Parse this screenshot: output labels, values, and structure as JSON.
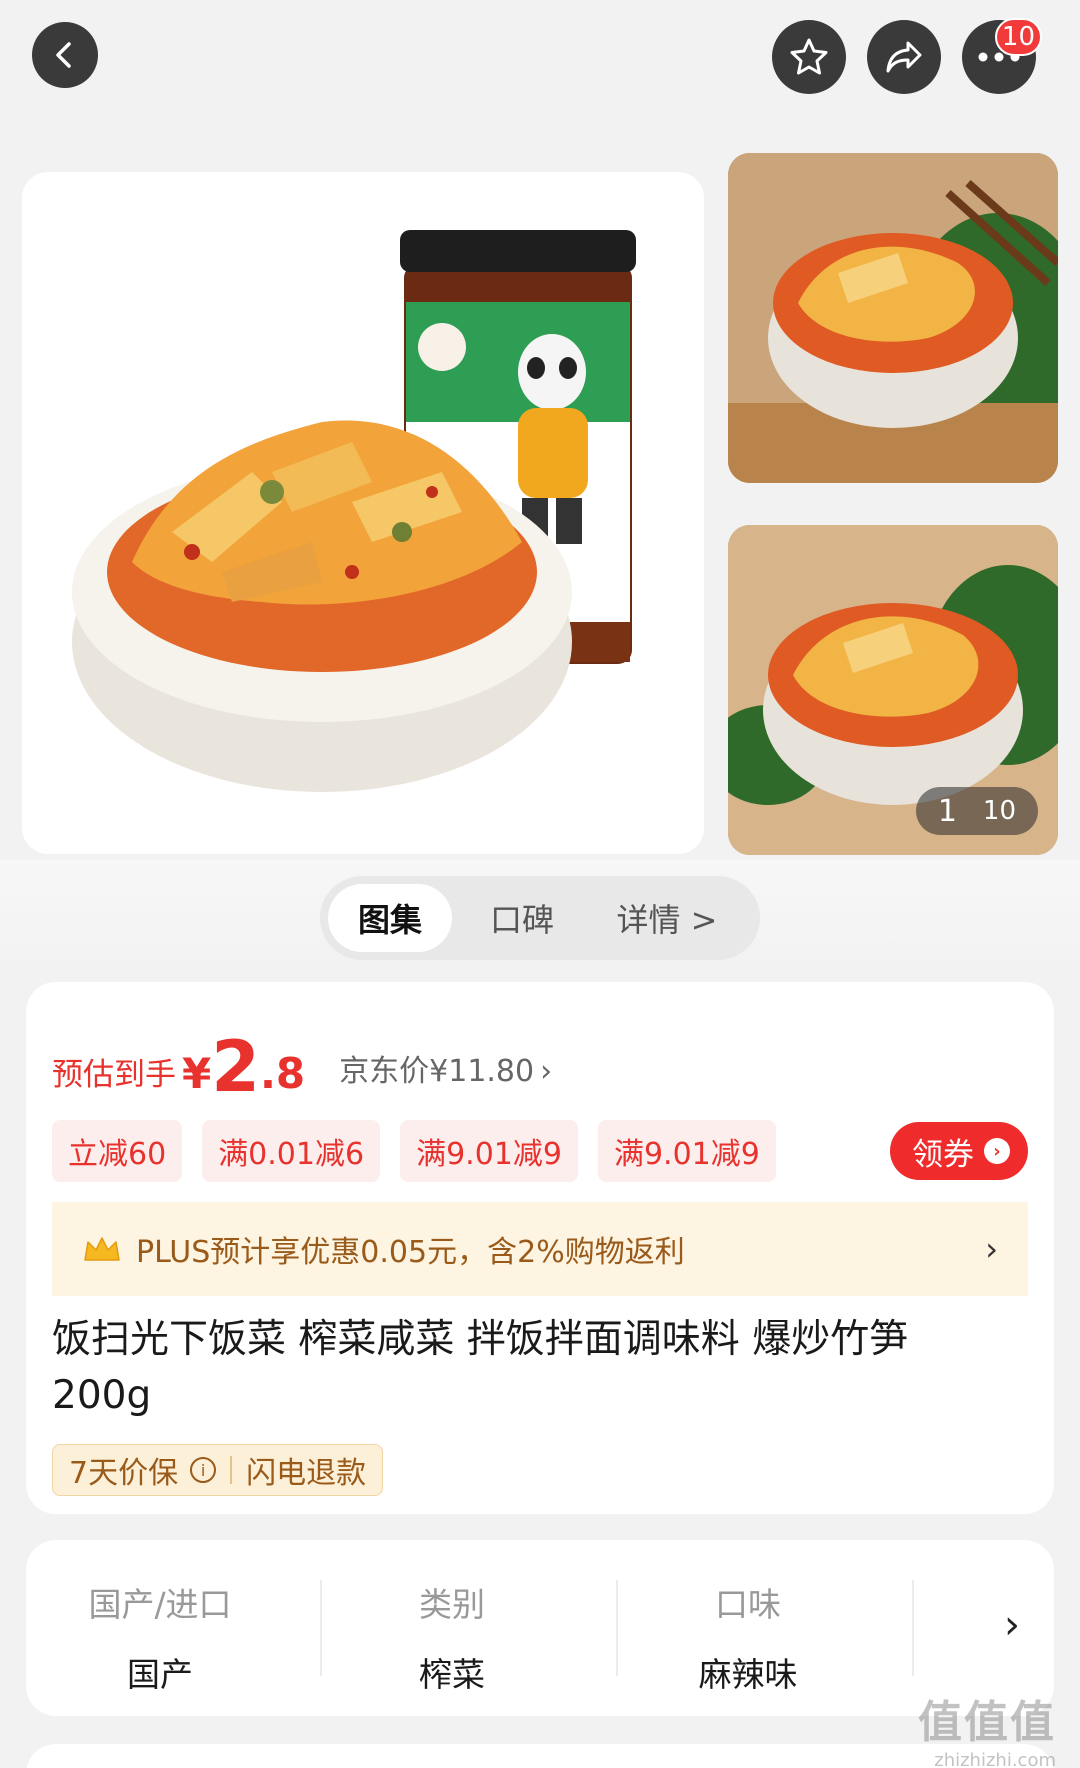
{
  "topbar": {
    "more_badge": "10"
  },
  "gallery": {
    "counter_current": "1",
    "counter_total": "10"
  },
  "tabs": {
    "gallery": "图集",
    "reviews": "口碑",
    "details": "详情 >"
  },
  "price": {
    "estimate_label": "预估到手",
    "currency": "¥",
    "integer": "2",
    "decimal": ".8",
    "jd_price": "京东价¥11.80",
    "jd_chevron": "›"
  },
  "promo_tags": [
    "立减60",
    "满0.01减6",
    "满9.01减9",
    "满9.01减9"
  ],
  "coupon": {
    "label": "领券",
    "chevron": "›"
  },
  "plus": {
    "text": "PLUS预计享优惠0.05元，含2%购物返利",
    "chevron": "›"
  },
  "product": {
    "title": "饭扫光下饭菜 榨菜咸菜 拌饭拌面调味料 爆炒竹笋 200g"
  },
  "guarantee": {
    "price_protect": "7天价保",
    "info": "i",
    "refund": "闪电退款"
  },
  "attributes": [
    {
      "label": "国产/进口",
      "value": "国产"
    },
    {
      "label": "类别",
      "value": "榨菜"
    },
    {
      "label": "口味",
      "value": "麻辣味"
    }
  ],
  "attr_chevron": "›",
  "watermark": {
    "big": "值值值",
    "small": "zhizhizhi.com"
  },
  "colors": {
    "accent_red": "#e8322e",
    "plus_gold": "#9a5a1a",
    "plus_bg": "#fdf4e1"
  }
}
